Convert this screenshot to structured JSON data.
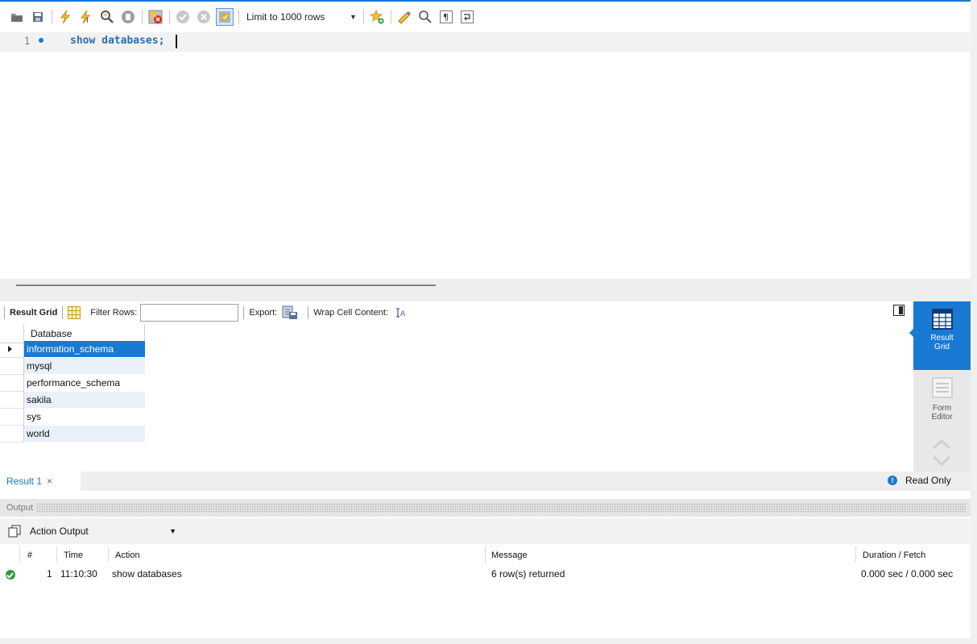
{
  "toolbar": {
    "limit_label": "Limit to 1000 rows",
    "icons": [
      "open-folder-icon",
      "save-icon",
      "execute-icon",
      "execute-current-icon",
      "explain-icon",
      "stop-icon",
      "toggle-error-icon",
      "commit-icon",
      "rollback-icon",
      "autocommit-icon",
      "add-snippet-icon",
      "beautify-icon",
      "find-icon",
      "invisible-chars-icon",
      "wrap-lines-icon"
    ]
  },
  "editor": {
    "line_number": "1",
    "code": "show databases;"
  },
  "result_toolbar": {
    "result_grid_label": "Result Grid",
    "filter_label": "Filter Rows:",
    "filter_value": "",
    "export_label": "Export:",
    "wrap_label": "Wrap Cell Content:"
  },
  "grid": {
    "header": "Database",
    "rows": [
      "information_schema",
      "mysql",
      "performance_schema",
      "sakila",
      "sys",
      "world"
    ],
    "selected_index": 0
  },
  "side_panel": {
    "result_grid_line1": "Result",
    "result_grid_line2": "Grid",
    "form_editor_line1": "Form",
    "form_editor_line2": "Editor"
  },
  "tabs": {
    "result_tab": "Result 1",
    "close_glyph": "×",
    "read_only": "Read Only"
  },
  "output": {
    "header": "Output",
    "selector": "Action Output",
    "columns": {
      "num": "#",
      "time": "Time",
      "action": "Action",
      "message": "Message",
      "duration": "Duration / Fetch"
    },
    "rows": [
      {
        "status": "ok",
        "num": "1",
        "time": "11:10:30",
        "action": "show databases",
        "message": "6 row(s) returned",
        "duration": "0.000 sec / 0.000 sec"
      }
    ]
  },
  "colors": {
    "accent": "#1a79d2",
    "success": "#2e9b3a"
  }
}
